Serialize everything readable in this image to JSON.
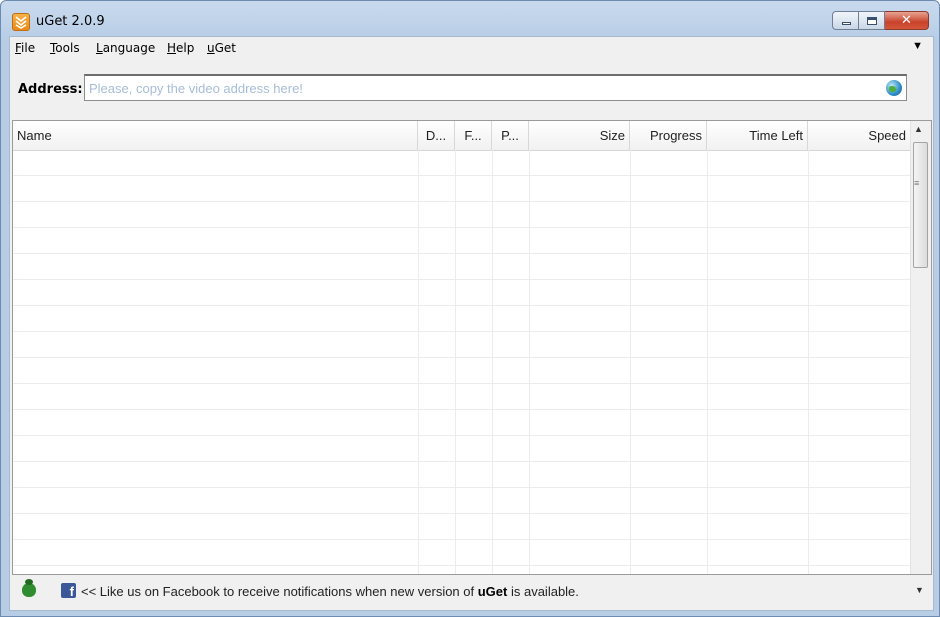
{
  "window": {
    "title": "uGet 2.0.9",
    "buttons": {
      "minimize": "minimize",
      "maximize": "maximize",
      "close": "✕"
    }
  },
  "menubar": {
    "items": [
      {
        "label": "File",
        "mnemonic": "F",
        "rest": "ile"
      },
      {
        "label": "Tools",
        "mnemonic": "T",
        "rest": "ools"
      },
      {
        "label": "Language",
        "mnemonic": "L",
        "rest": "anguage"
      },
      {
        "label": "Help",
        "mnemonic": "H",
        "rest": "elp"
      },
      {
        "label": "uGet",
        "mnemonic": "u",
        "rest": "Get"
      }
    ],
    "overflow": "▼"
  },
  "address": {
    "label": "Address:",
    "value": "",
    "placeholder": "Please, copy the video address here!",
    "icon": "globe-icon"
  },
  "table": {
    "columns": [
      "Name",
      "D...",
      "F...",
      "P...",
      "Size",
      "Progress",
      "Time Left",
      "Speed"
    ],
    "rows": []
  },
  "scrollbar": {
    "up": "▲",
    "grip": "≡",
    "down": "▼"
  },
  "statusbar": {
    "bug_icon": "bug-icon",
    "fb_icon": "f",
    "message_prefix": "<< Like us on Facebook to receive notifications when new version of ",
    "message_bold": "uGet",
    "message_suffix": " is available."
  },
  "colors": {
    "accent": "#3b5998",
    "placeholder": "#a7bcd8",
    "titlebar": "#c9daee"
  }
}
